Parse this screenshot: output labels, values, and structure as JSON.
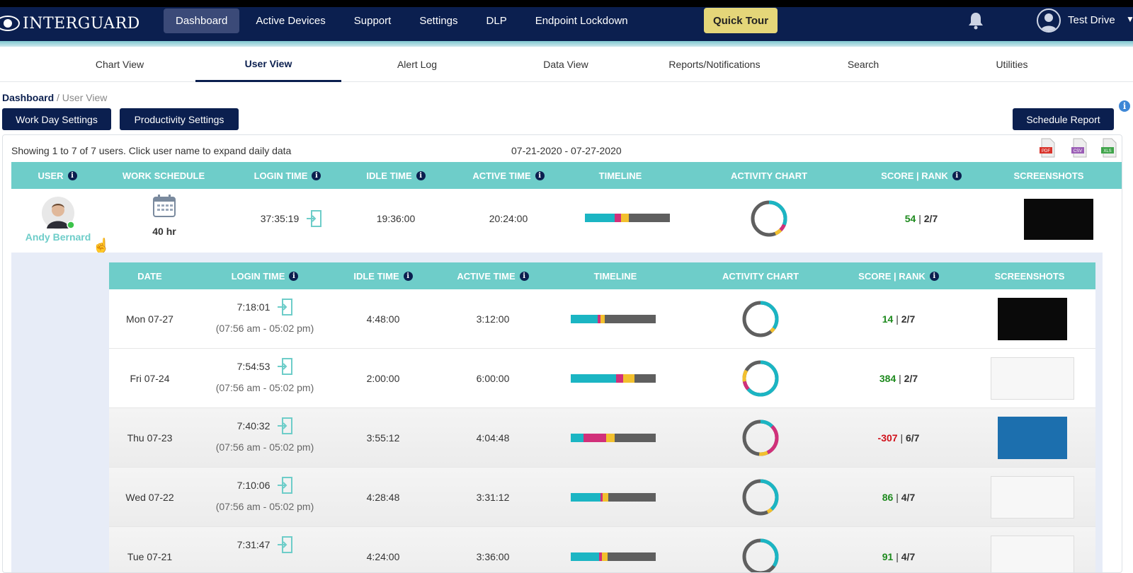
{
  "header": {
    "brand": "INTERGUARD",
    "nav": [
      "Dashboard",
      "Active Devices",
      "Support",
      "Settings",
      "DLP",
      "Endpoint Lockdown"
    ],
    "quick_tour": "Quick Tour",
    "user": "Test Drive"
  },
  "tabs": [
    "Chart View",
    "User View",
    "Alert Log",
    "Data View",
    "Reports/Notifications",
    "Search",
    "Utilities"
  ],
  "breadcrumb": {
    "root": "Dashboard",
    "sep": " / ",
    "current": "User View"
  },
  "buttons": {
    "work_day": "Work Day Settings",
    "productivity": "Productivity Settings",
    "schedule": "Schedule Report"
  },
  "summary": {
    "showing": "Showing 1 to 7 of 7 users.   Click user name to expand daily data",
    "range": "07-21-2020 - 07-27-2020"
  },
  "exports": [
    "PDF",
    "CSV",
    "XLS"
  ],
  "main_headers": [
    "USER",
    "WORK SCHEDULE",
    "LOGIN TIME",
    "IDLE TIME",
    "ACTIVE TIME",
    "TIMELINE",
    "ACTIVITY CHART",
    "SCORE | RANK",
    "SCREENSHOTS"
  ],
  "user_row": {
    "name": "Andy Bernard",
    "schedule": "40 hr",
    "login": "37:35:19",
    "idle": "19:36:00",
    "active": "20:24:00",
    "score": "54",
    "rank": "2/7"
  },
  "detail_headers": [
    "DATE",
    "LOGIN TIME",
    "IDLE TIME",
    "ACTIVE TIME",
    "TIMELINE",
    "ACTIVITY CHART",
    "SCORE | RANK",
    "SCREENSHOTS"
  ],
  "detail_rows": [
    {
      "date": "Mon 07-27",
      "login": "7:18:01",
      "hours": "(07:56 am - 05:02 pm)",
      "idle": "4:48:00",
      "active": "3:12:00",
      "score": "14",
      "rank": "2/7"
    },
    {
      "date": "Fri 07-24",
      "login": "7:54:53",
      "hours": "(07:56 am - 05:02 pm)",
      "idle": "2:00:00",
      "active": "6:00:00",
      "score": "384",
      "rank": "2/7"
    },
    {
      "date": "Thu 07-23",
      "login": "7:40:32",
      "hours": "(07:56 am - 05:02 pm)",
      "idle": "3:55:12",
      "active": "4:04:48",
      "score": "-307",
      "rank": "6/7"
    },
    {
      "date": "Wed 07-22",
      "login": "7:10:06",
      "hours": "(07:56 am - 05:02 pm)",
      "idle": "4:28:48",
      "active": "3:31:12",
      "score": "86",
      "rank": "4/7"
    },
    {
      "date": "Tue 07-21",
      "login": "7:31:47",
      "hours": "",
      "idle": "4:24:00",
      "active": "3:36:00",
      "score": "91",
      "rank": "4/7"
    }
  ],
  "colors": {
    "navy": "#0b1f4f",
    "teal": "#1bb5c3",
    "magenta": "#d1307a",
    "yellow": "#f2c02e",
    "gray": "#5f5f5f",
    "header_teal": "#6ecdc9"
  }
}
